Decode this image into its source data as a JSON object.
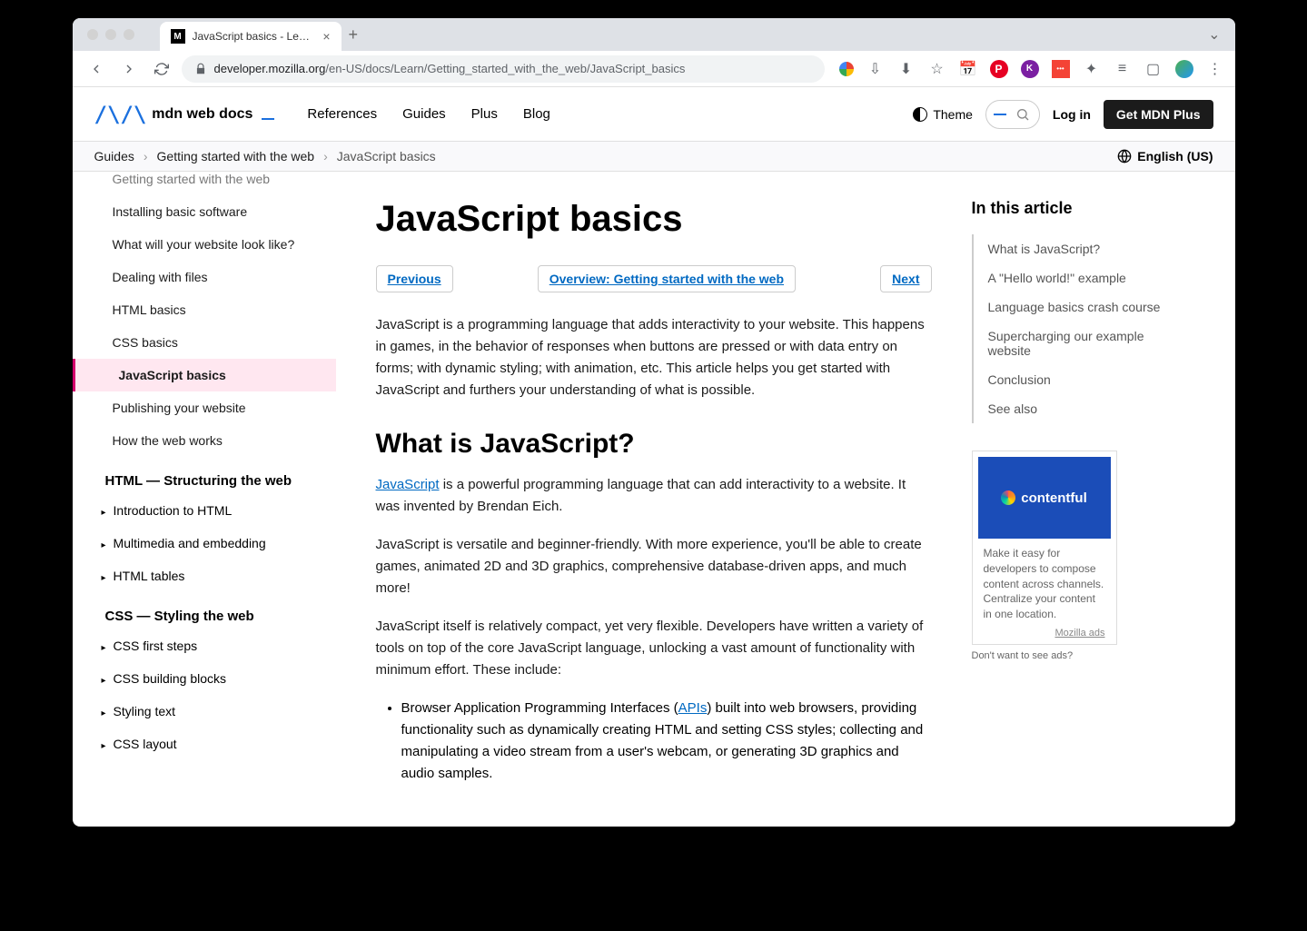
{
  "browser": {
    "tab_title": "JavaScript basics - Learn web",
    "url_domain": "developer.mozilla.org",
    "url_path": "/en-US/docs/Learn/Getting_started_with_the_web/JavaScript_basics"
  },
  "header": {
    "logo_text": "mdn web docs",
    "nav": [
      "References",
      "Guides",
      "Plus",
      "Blog"
    ],
    "theme_label": "Theme",
    "login_label": "Log in",
    "plus_label": "Get MDN Plus"
  },
  "breadcrumb": {
    "items": [
      "Guides",
      "Getting started with the web"
    ],
    "current": "JavaScript basics",
    "language": "English (US)"
  },
  "sidebar": {
    "group1": [
      "Getting started with the web",
      "Installing basic software",
      "What will your website look like?",
      "Dealing with files",
      "HTML basics",
      "CSS basics",
      "JavaScript basics",
      "Publishing your website",
      "How the web works"
    ],
    "active_index": 6,
    "subhead1": "HTML — Structuring the web",
    "group2": [
      "Introduction to HTML",
      "Multimedia and embedding",
      "HTML tables"
    ],
    "subhead2": "CSS — Styling the web",
    "group3": [
      "CSS first steps",
      "CSS building blocks",
      "Styling text",
      "CSS layout"
    ]
  },
  "article": {
    "title": "JavaScript basics",
    "prev_label": "Previous",
    "overview_label": "Overview: Getting started with the web",
    "next_label": "Next",
    "intro": "JavaScript is a programming language that adds interactivity to your website. This happens in games, in the behavior of responses when buttons are pressed or with data entry on forms; with dynamic styling; with animation, etc. This article helps you get started with JavaScript and furthers your understanding of what is possible.",
    "h2_1": "What is JavaScript?",
    "js_link": "JavaScript",
    "p1_rest": " is a powerful programming language that can add interactivity to a website. It was invented by Brendan Eich.",
    "p2": "JavaScript is versatile and beginner-friendly. With more experience, you'll be able to create games, animated 2D and 3D graphics, comprehensive database-driven apps, and much more!",
    "p3": "JavaScript itself is relatively compact, yet very flexible. Developers have written a variety of tools on top of the core JavaScript language, unlocking a vast amount of functionality with minimum effort. These include:",
    "li1_pre": "Browser Application Programming Interfaces (",
    "li1_link": "APIs",
    "li1_post": ") built into web browsers, providing functionality such as dynamically creating HTML and setting CSS styles; collecting and manipulating a video stream from a user's webcam, or generating 3D graphics and audio samples."
  },
  "toc": {
    "heading": "In this article",
    "items": [
      "What is JavaScript?",
      "A \"Hello world!\" example",
      "Language basics crash course",
      "Supercharging our example website",
      "Conclusion",
      "See also"
    ]
  },
  "ad": {
    "brand": "contentful",
    "text": "Make it easy for developers to compose content across channels. Centralize your content in one location.",
    "link": "Mozilla ads",
    "opt_out": "Don't want to see ads?"
  }
}
